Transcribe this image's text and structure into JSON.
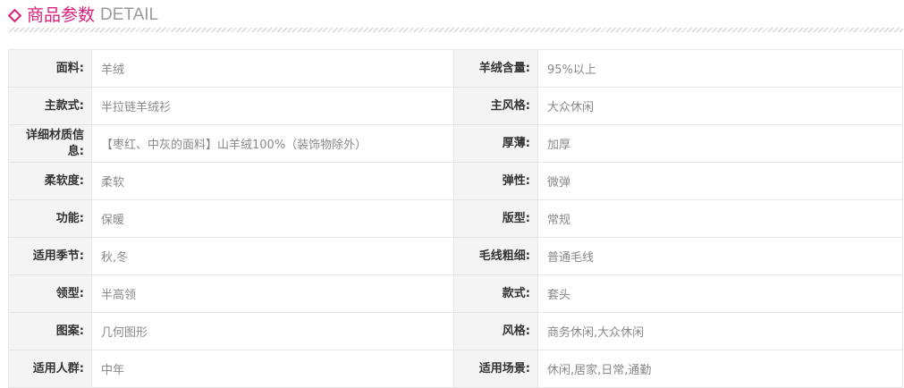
{
  "header": {
    "title_cn": "商品参数",
    "title_en": "DETAIL"
  },
  "rows": [
    {
      "left_label": "面料:",
      "left_value": "羊绒",
      "right_label": "羊绒含量:",
      "right_value": "95%以上"
    },
    {
      "left_label": "主款式:",
      "left_value": "半拉链羊绒衫",
      "right_label": "主风格:",
      "right_value": "大众休闲"
    },
    {
      "left_label": "详细材质信息:",
      "left_value": "【枣红、中灰的面料】山羊绒100%（装饰物除外）",
      "right_label": "厚薄:",
      "right_value": "加厚"
    },
    {
      "left_label": "柔软度:",
      "left_value": "柔软",
      "right_label": "弹性:",
      "right_value": "微弹"
    },
    {
      "left_label": "功能:",
      "left_value": "保暖",
      "right_label": "版型:",
      "right_value": "常规"
    },
    {
      "left_label": "适用季节:",
      "left_value": "秋,冬",
      "right_label": "毛线粗细:",
      "right_value": "普通毛线"
    },
    {
      "left_label": "领型:",
      "left_value": "半高领",
      "right_label": "款式:",
      "right_value": "套头"
    },
    {
      "left_label": "图案:",
      "left_value": "几何图形",
      "right_label": "风格:",
      "right_value": "商务休闲,大众休闲"
    },
    {
      "left_label": "适用人群:",
      "left_value": "中年",
      "right_label": "适用场景:",
      "right_value": "休闲,居家,日常,通勤"
    }
  ],
  "colors": {
    "accent": "#d81e7a",
    "label_bg": "#f4f4f4",
    "border": "#e6e6e6",
    "value_text": "#888888"
  },
  "icons": {
    "title_marker": "diamond-icon"
  }
}
